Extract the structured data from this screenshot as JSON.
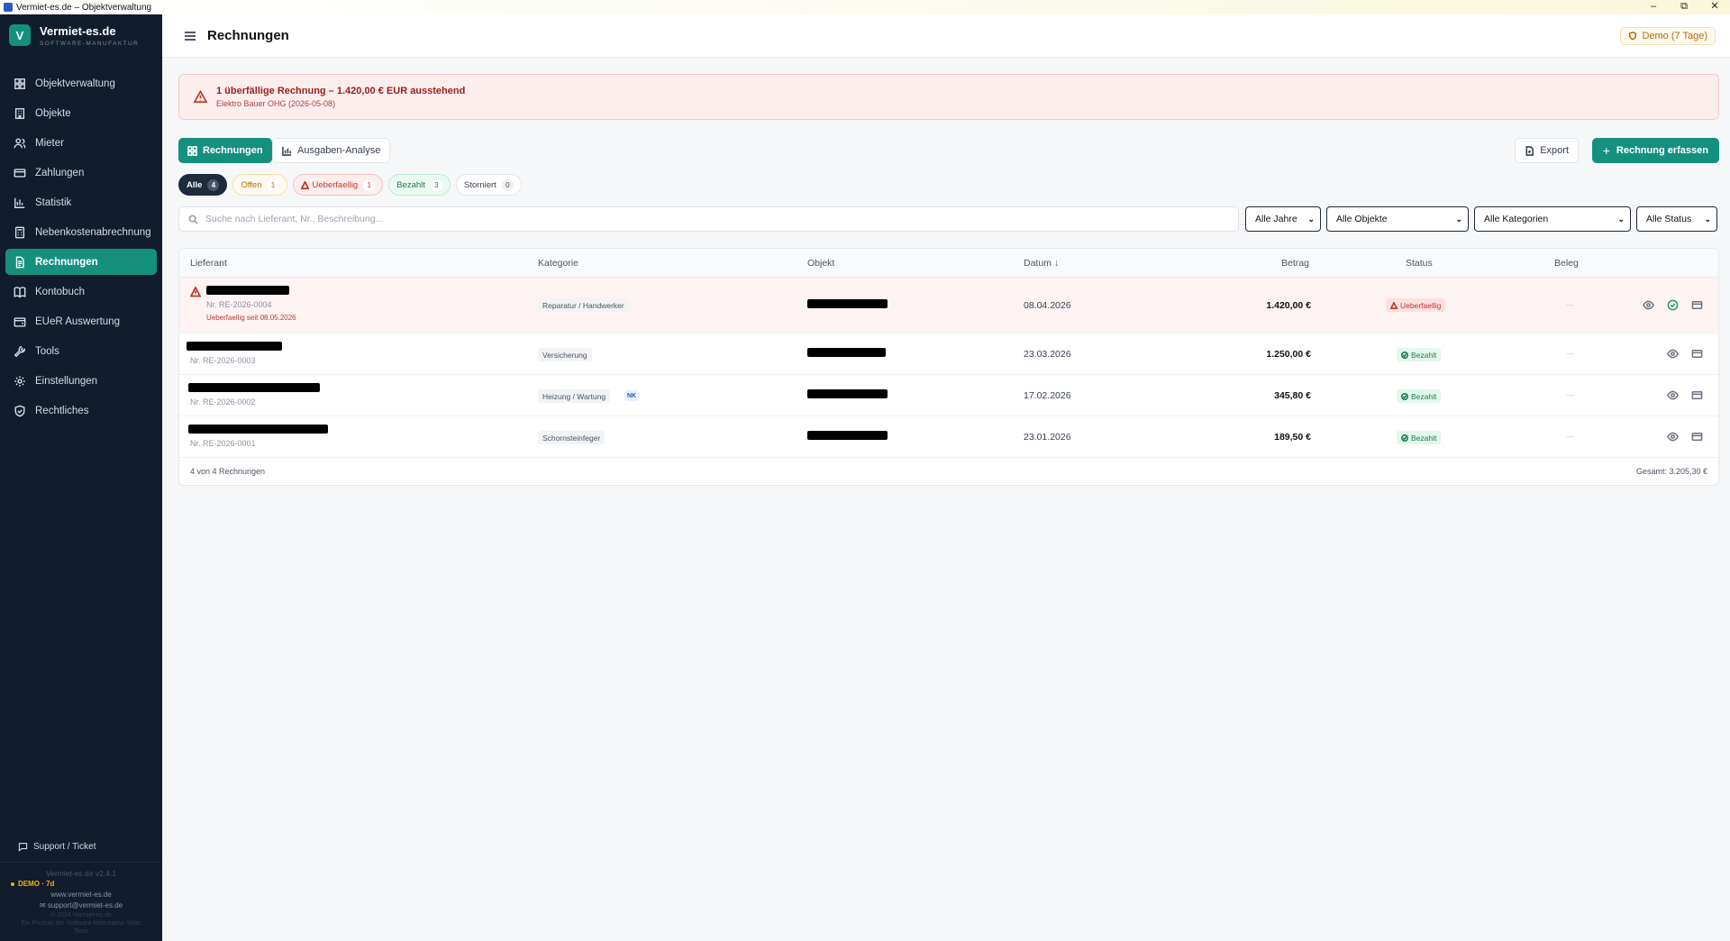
{
  "window": {
    "title": "Vermiet-es.de – Objektverwaltung",
    "controls": [
      "–",
      "⧉",
      "✕"
    ]
  },
  "brand": {
    "name": "Vermiet-es.de",
    "sub": "SOFTWARE-MANUFAKTUR",
    "logo": "V"
  },
  "sidebar": {
    "items": [
      {
        "label": "Objektverwaltung",
        "icon": "dashboard-icon"
      },
      {
        "label": "Objekte",
        "icon": "building-icon"
      },
      {
        "label": "Mieter",
        "icon": "users-icon"
      },
      {
        "label": "Zahlungen",
        "icon": "credit-card-icon"
      },
      {
        "label": "Statistik",
        "icon": "bar-chart-icon"
      },
      {
        "label": "Nebenkostenabrechnung",
        "icon": "calculator-icon"
      },
      {
        "label": "Rechnungen",
        "icon": "file-text-icon",
        "active": true
      },
      {
        "label": "Kontobuch",
        "icon": "book-icon"
      },
      {
        "label": "EUeR Auswertung",
        "icon": "wallet-icon"
      },
      {
        "label": "Tools",
        "icon": "wrench-icon"
      },
      {
        "label": "Einstellungen",
        "icon": "gear-icon"
      },
      {
        "label": "Rechtliches",
        "icon": "shield-icon"
      }
    ],
    "support": "Support / Ticket",
    "version": "Vermiet-es.de v2.4.1",
    "demo": "DEMO · 7d",
    "website": "www.vermiet-es.de",
    "email": "support@vermiet-es.de",
    "copyright": "© 2024 Vermiet-es.de",
    "product_note": "Ein Produkt der Software-Manufaktur Witte",
    "product_note2": "Tools"
  },
  "header": {
    "title": "Rechnungen",
    "demo_badge": "Demo (7 Tage)"
  },
  "alert": {
    "title": "1 überfällige Rechnung – 1.420,00 € EUR ausstehend",
    "subtitle": "Elektro Bauer OHG (2026-05-08)"
  },
  "toolbar": {
    "tab_invoices": "Rechnungen",
    "tab_analysis": "Ausgaben-Analyse",
    "export": "Export",
    "new_invoice": "Rechnung erfassen"
  },
  "filters": {
    "pills": [
      {
        "label": "Alle",
        "count": "4"
      },
      {
        "label": "Offen",
        "count": "1"
      },
      {
        "label": "Ueberfaellig",
        "count": "1"
      },
      {
        "label": "Bezahlt",
        "count": "3"
      },
      {
        "label": "Storniert",
        "count": "0"
      }
    ],
    "search_placeholder": "Suche nach Lieferant, Nr., Beschreibung...",
    "year": "Alle Jahre",
    "object": "Alle Objekte",
    "category": "Alle Kategorien",
    "status": "Alle Status"
  },
  "table": {
    "headers": {
      "supplier": "Lieferant",
      "category": "Kategorie",
      "object": "Objekt",
      "date": "Datum ↓",
      "amount": "Betrag",
      "status": "Status",
      "receipt": "Beleg"
    },
    "rows": [
      {
        "nr": "Nr. RE-2026-0004",
        "overdue_note": "Ueberfaellig seit 08.05.2026",
        "category": "Reparatur / Handwerker",
        "date": "08.04.2026",
        "amount": "1.420,00 €",
        "status": "Ueberfaellig",
        "receipt": "—"
      },
      {
        "nr": "Nr. RE-2026-0003",
        "category": "Versicherung",
        "date": "23.03.2026",
        "amount": "1.250,00 €",
        "status": "Bezahlt",
        "receipt": "—"
      },
      {
        "nr": "Nr. RE-2026-0002",
        "category": "Heizung / Wartung",
        "nk": "NK",
        "date": "17.02.2026",
        "amount": "345,80 €",
        "status": "Bezahlt",
        "receipt": "—"
      },
      {
        "nr": "Nr. RE-2026-0001",
        "category": "Schornsteinfeger",
        "date": "23.01.2026",
        "amount": "189,50 €",
        "status": "Bezahlt",
        "receipt": "—"
      }
    ],
    "footer_count": "4 von 4 Rechnungen",
    "footer_total": "Gesamt: 3.205,30 €"
  }
}
